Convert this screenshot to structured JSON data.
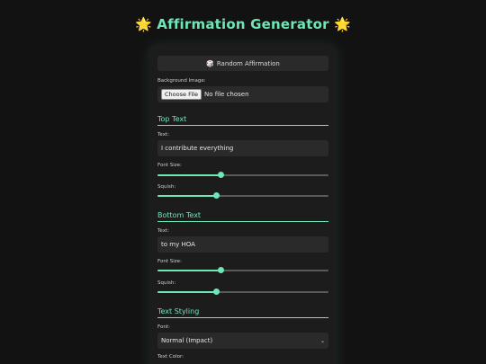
{
  "app": {
    "title": "Affirmation Generator",
    "title_emoji": "🌟"
  },
  "controls": {
    "random_button": "Random Affirmation",
    "random_button_icon": "🎲",
    "background_label": "Background Image:",
    "file_button": "Choose File",
    "file_status": "No file chosen"
  },
  "top_text": {
    "heading": "Top Text",
    "text_label": "Text:",
    "text_value": "I contribute everything",
    "font_size_label": "Font Size:",
    "font_size_level": 0.37,
    "squish_label": "Squish:",
    "squish_level": 0.34
  },
  "bottom_text": {
    "heading": "Bottom Text",
    "text_label": "Text:",
    "text_value": "to my HOA",
    "font_size_label": "Font Size:",
    "font_size_level": 0.37,
    "squish_label": "Squish:",
    "squish_level": 0.34
  },
  "styling": {
    "heading": "Text Styling",
    "font_label": "Font:",
    "font_value": "Normal (Impact)",
    "color_label": "Text Color:"
  },
  "colors": {
    "accent": "#6ee7b7",
    "background": "#121212",
    "panel": "#1c1c1c",
    "field": "#2a2a2a"
  }
}
